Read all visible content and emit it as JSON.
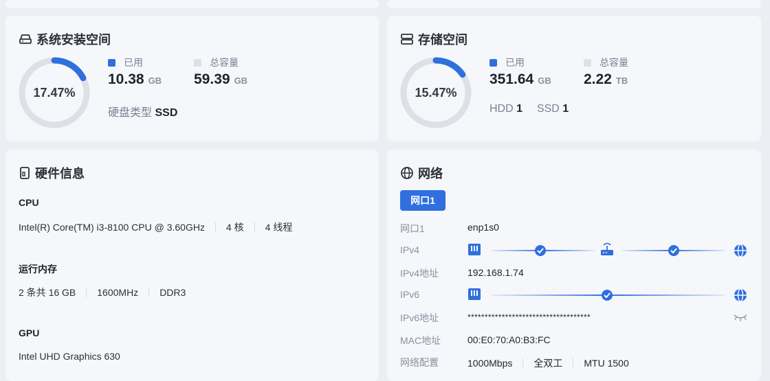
{
  "system_space": {
    "title": "系统安装空间",
    "percent_label": "17.47%",
    "percent": 17.47,
    "used_label": "已用",
    "used_value": "10.38",
    "used_unit": "GB",
    "total_label": "总容量",
    "total_value": "59.39",
    "total_unit": "GB",
    "disk_type_label": "硬盘类型",
    "disk_type_value": "SSD"
  },
  "storage": {
    "title": "存储空间",
    "percent_label": "15.47%",
    "percent": 15.47,
    "used_label": "已用",
    "used_value": "351.64",
    "used_unit": "GB",
    "total_label": "总容量",
    "total_value": "2.22",
    "total_unit": "TB",
    "hdd_label": "HDD",
    "hdd_count": "1",
    "ssd_label": "SSD",
    "ssd_count": "1"
  },
  "hardware": {
    "title": "硬件信息",
    "cpu_label": "CPU",
    "cpu_model": "Intel(R) Core(TM) i3-8100 CPU @ 3.60GHz",
    "cpu_cores": "4 核",
    "cpu_threads": "4 线程",
    "mem_label": "运行内存",
    "mem_total": "2 条共 16 GB",
    "mem_freq": "1600MHz",
    "mem_type": "DDR3",
    "gpu_label": "GPU",
    "gpu_model": "Intel UHD Graphics 630"
  },
  "network": {
    "title": "网络",
    "tab": "网口1",
    "port_key": "网口1",
    "port_value": "enp1s0",
    "ipv4_key": "IPv4",
    "ipv4_addr_key": "IPv4地址",
    "ipv4_addr_value": "192.168.1.74",
    "ipv6_key": "IPv6",
    "ipv6_addr_key": "IPv6地址",
    "ipv6_addr_value": "************************************",
    "mac_key": "MAC地址",
    "mac_value": "00:E0:70:A0:B3:FC",
    "config_key": "网络配置",
    "speed": "1000Mbps",
    "duplex": "全双工",
    "mtu": "MTU 1500"
  },
  "colors": {
    "accent": "#2f6fde",
    "track": "#dde1e7",
    "total_square": "#dde1e7"
  }
}
